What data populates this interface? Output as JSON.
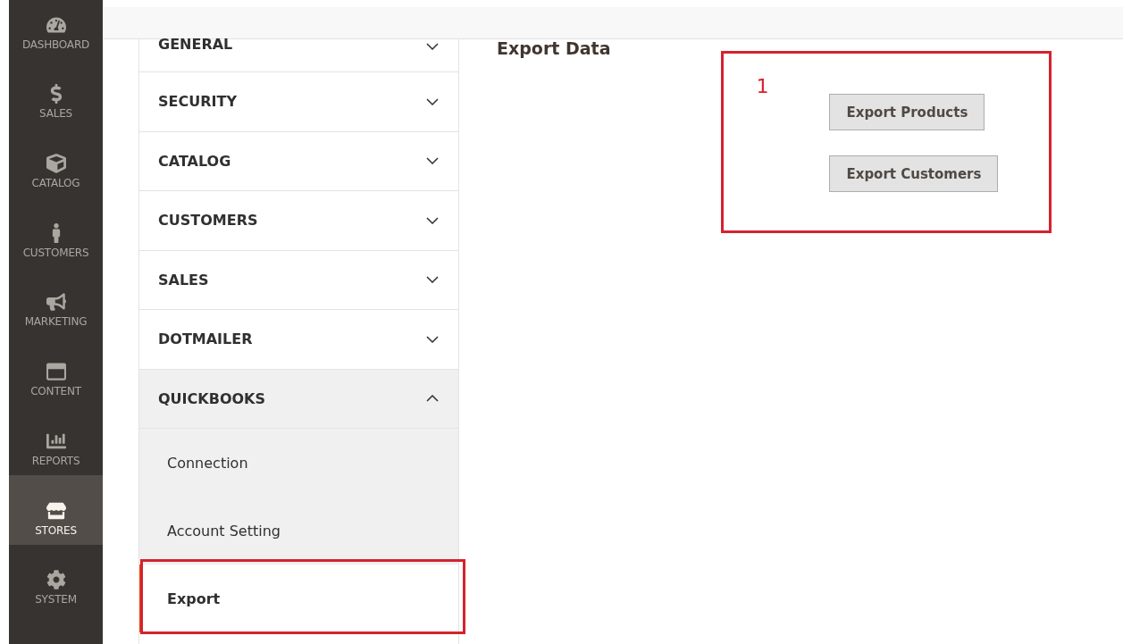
{
  "sidebar": {
    "items": [
      {
        "label": "DASHBOARD",
        "selected": false
      },
      {
        "label": "SALES",
        "selected": false
      },
      {
        "label": "CATALOG",
        "selected": false
      },
      {
        "label": "CUSTOMERS",
        "selected": false
      },
      {
        "label": "MARKETING",
        "selected": false
      },
      {
        "label": "CONTENT",
        "selected": false
      },
      {
        "label": "REPORTS",
        "selected": false
      },
      {
        "label": "STORES",
        "selected": true
      },
      {
        "label": "SYSTEM",
        "selected": false
      }
    ]
  },
  "config_nav": {
    "sections": [
      {
        "label": "GENERAL",
        "expanded": false
      },
      {
        "label": "SECURITY",
        "expanded": false
      },
      {
        "label": "CATALOG",
        "expanded": false
      },
      {
        "label": "CUSTOMERS",
        "expanded": false
      },
      {
        "label": "SALES",
        "expanded": false
      },
      {
        "label": "DOTMAILER",
        "expanded": false
      },
      {
        "label": "QUICKBOOKS",
        "expanded": true,
        "children": [
          {
            "label": "Connection",
            "selected": false,
            "highlighted": false
          },
          {
            "label": "Account Setting",
            "selected": false,
            "highlighted": false
          },
          {
            "label": "Export",
            "selected": true,
            "highlighted": true
          }
        ]
      }
    ]
  },
  "content": {
    "heading": "Export Data",
    "callout": {
      "label": "1"
    },
    "buttons": [
      "Export Products",
      "Export Customers"
    ]
  }
}
